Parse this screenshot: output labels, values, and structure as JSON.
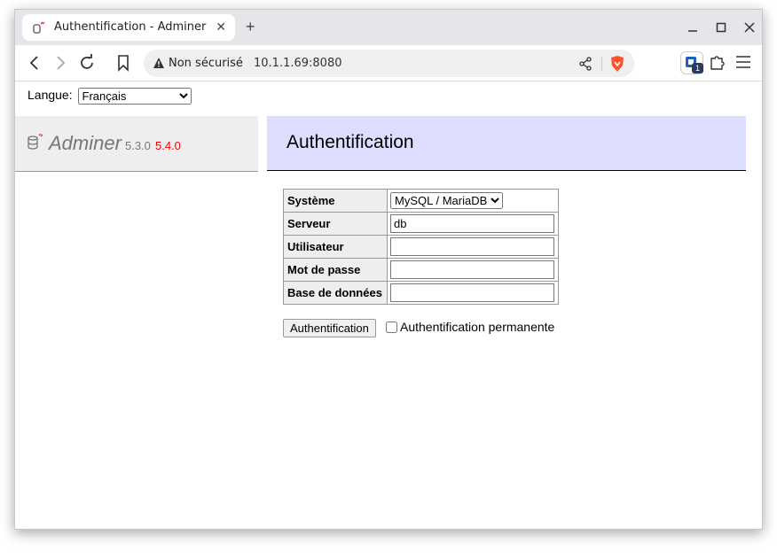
{
  "browser": {
    "tab_title": "Authentification - Adminer",
    "new_tab": "+",
    "security_label": "Non sécurisé",
    "url": "10.1.1.69:8080",
    "extension_badge": "1"
  },
  "page": {
    "language_label": "Langue:",
    "language_value": "Français",
    "app_name": "Adminer",
    "version": "5.3.0",
    "new_version": "5.4.0",
    "heading": "Authentification",
    "fields": [
      {
        "label": "Système",
        "value": "MySQL / MariaDB"
      },
      {
        "label": "Serveur",
        "value": "db"
      },
      {
        "label": "Utilisateur",
        "value": ""
      },
      {
        "label": "Mot de passe",
        "value": ""
      },
      {
        "label": "Base de données",
        "value": ""
      }
    ],
    "submit_label": "Authentification",
    "permanent_label": "Authentification permanente"
  },
  "colors": {
    "heading_bg": "#ddddff",
    "new_version": "#ee0000"
  }
}
